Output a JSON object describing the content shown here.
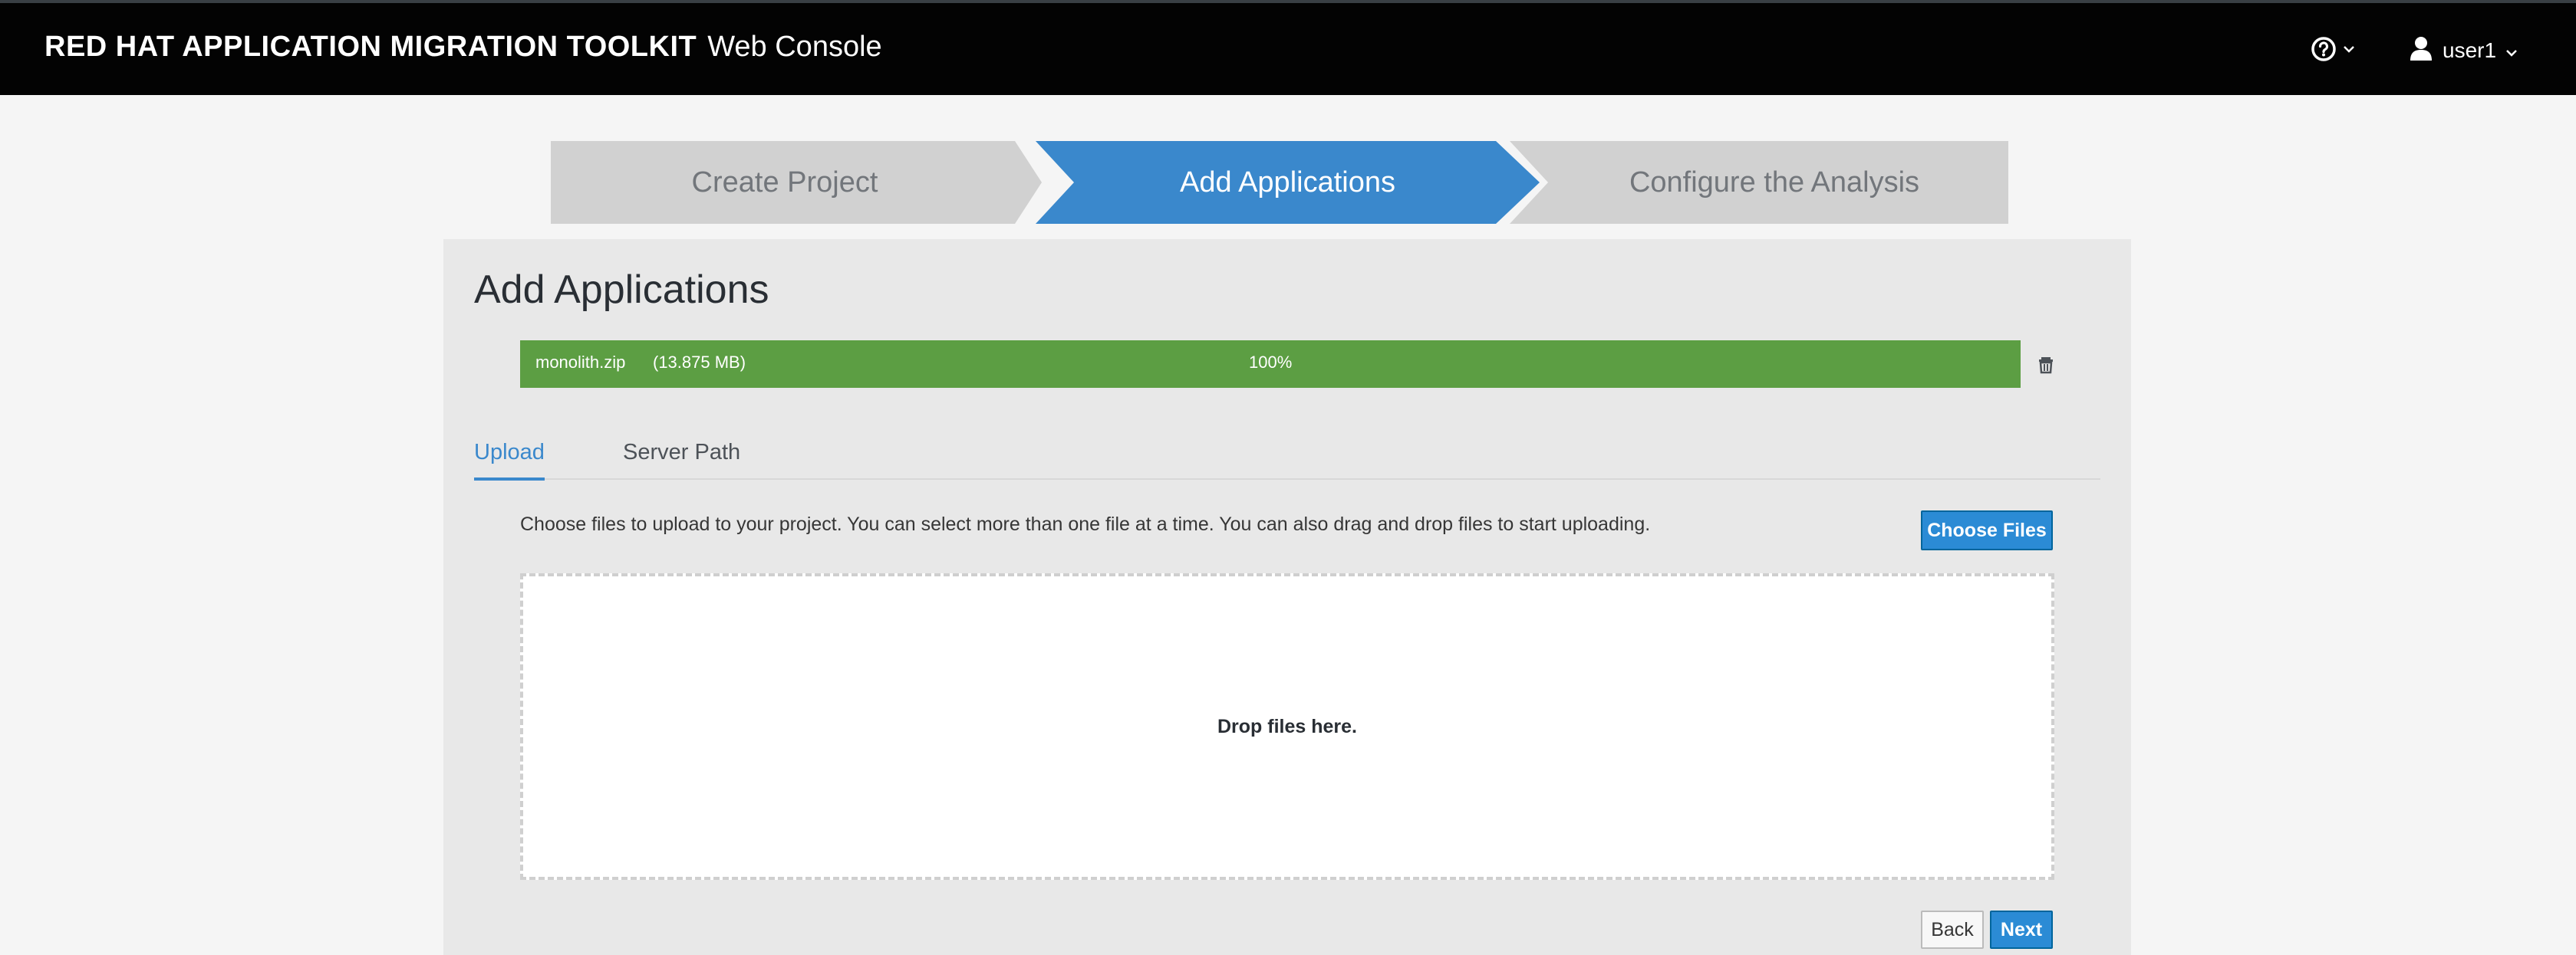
{
  "header": {
    "brand_strong": "RED HAT APPLICATION MIGRATION TOOLKIT",
    "brand_light": "Web Console",
    "help_icon": "question-circle-icon",
    "user_name": "user1",
    "user_icon": "user-icon"
  },
  "wizard": {
    "steps": [
      {
        "label": "Create Project",
        "state": "complete"
      },
      {
        "label": "Add Applications",
        "state": "active"
      },
      {
        "label": "Configure the Analysis",
        "state": "pending"
      }
    ]
  },
  "panel": {
    "title": "Add Applications",
    "upload": {
      "file_name": "monolith.zip",
      "file_size": "(13.875 MB)",
      "percent_label": "100%",
      "progress": 1.0,
      "delete_icon": "trash-icon"
    },
    "tabs": [
      {
        "label": "Upload",
        "active": true
      },
      {
        "label": "Server Path",
        "active": false
      }
    ],
    "description": "Choose files to upload to your project. You can select more than one file at a time. You can also drag and drop files to start uploading.",
    "choose_files_label": "Choose Files",
    "dropzone_text": "Drop files here.",
    "back_label": "Back",
    "next_label": "Next"
  },
  "colors": {
    "header_bg": "#030303",
    "active_step": "#3a88cc",
    "inactive_step": "#d1d1d1",
    "progress_fill": "#5c9e43",
    "primary_button": "#2b8bd5"
  }
}
